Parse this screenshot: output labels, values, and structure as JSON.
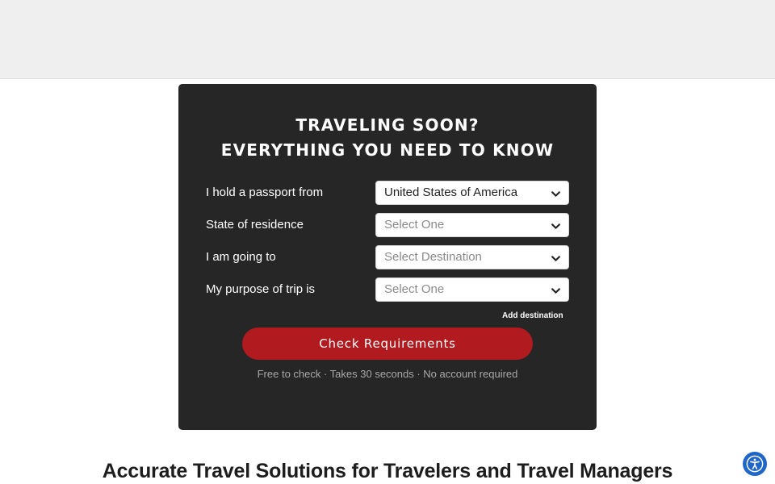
{
  "form": {
    "title_line1": "TRAVELING SOON?",
    "title_line2": "EVERYTHING YOU NEED TO KNOW",
    "rows": [
      {
        "label": "I hold a passport from",
        "value": "United States of America",
        "placeholder": false
      },
      {
        "label": "State of residence",
        "value": "Select One",
        "placeholder": true
      },
      {
        "label": "I am going to",
        "value": "Select Destination",
        "placeholder": true
      },
      {
        "label": "My purpose of trip is",
        "value": "Select One",
        "placeholder": true
      }
    ],
    "add_destination": "Add destination",
    "cta_label": "Check Requirements",
    "note": "Free to check · Takes 30 seconds · No account required"
  },
  "headline": "Accurate Travel Solutions for Travelers and Travel Managers",
  "icons": {
    "select_arrow": "chevron-down-icon",
    "accessibility": "accessibility-icon"
  },
  "colors": {
    "card_bg": "#262626",
    "cta_bg": "#b11a1f",
    "accessibility_bg": "#1f66c8",
    "top_band_bg": "#efefef"
  }
}
